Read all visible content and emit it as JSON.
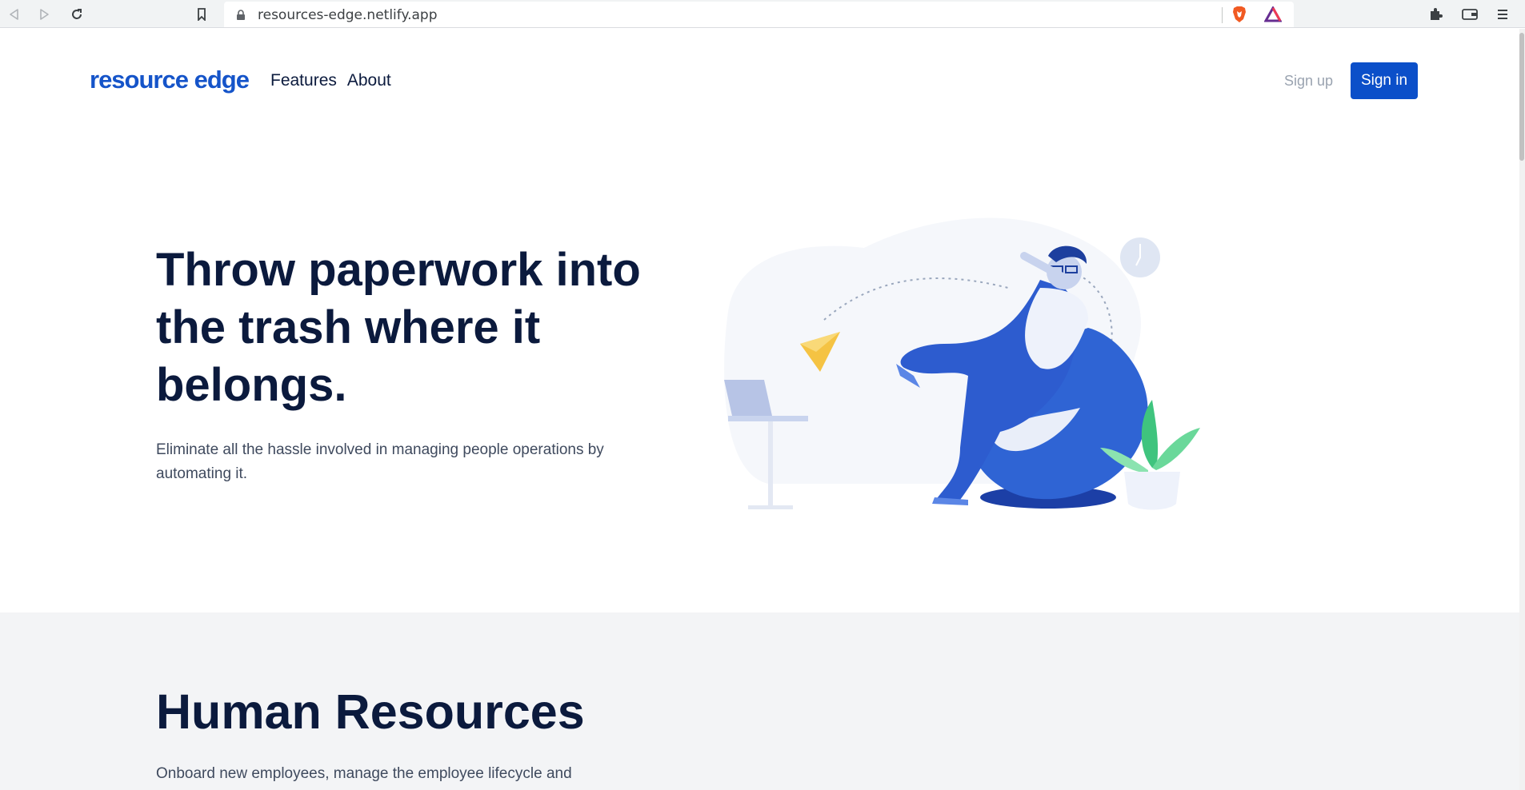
{
  "browser": {
    "url": "resources-edge.netlify.app"
  },
  "header": {
    "logo": "resource edge",
    "nav": [
      "Features",
      "About"
    ],
    "signup_label": "Sign up",
    "signin_label": "Sign in"
  },
  "hero": {
    "title": "Throw paperwork into the trash where it belongs.",
    "subtitle": "Eliminate all the hassle involved in managing people operations by automating it."
  },
  "hr_section": {
    "title": "Human Resources",
    "subtitle": "Onboard new employees, manage the employee lifecycle and"
  },
  "colors": {
    "brand": "#1554c9",
    "primary_button": "#0b4fc9",
    "heading": "#0b1a3d",
    "section_bg": "#f3f4f6"
  },
  "icons": [
    "back-icon",
    "forward-icon",
    "reload-icon",
    "bookmark-icon",
    "lock-icon",
    "brave-shield-icon",
    "brave-rewards-icon",
    "extensions-icon",
    "wallet-icon",
    "menu-icon"
  ]
}
